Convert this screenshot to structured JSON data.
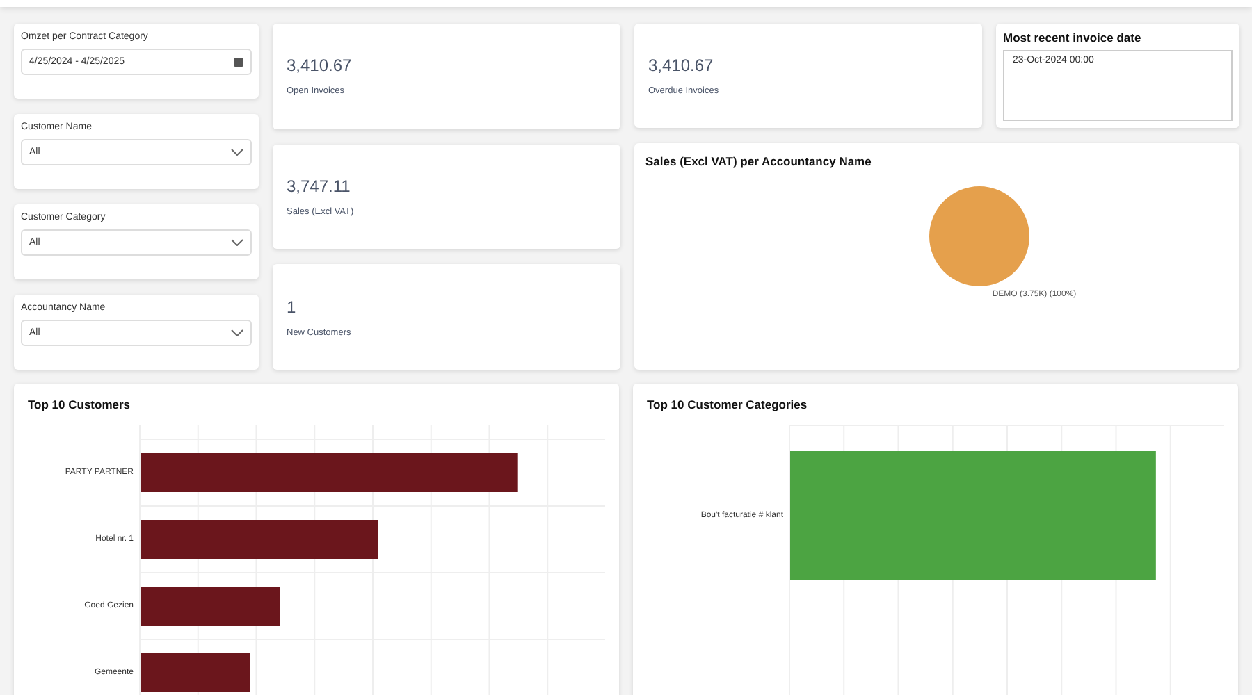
{
  "filters": [
    {
      "kind": "date",
      "label": "Omzet per Contract Category",
      "value": "4/25/2024 - 4/25/2025"
    },
    {
      "kind": "dropdown",
      "label": "Customer Name",
      "value": "All"
    },
    {
      "kind": "dropdown",
      "label": "Customer Category",
      "value": "All"
    },
    {
      "kind": "dropdown",
      "label": "Accountancy Name",
      "value": "All"
    }
  ],
  "kpis": [
    {
      "value": "3,410.67",
      "label": "Open Invoices"
    },
    {
      "value": "3,747.11",
      "label": "Sales (Excl VAT)"
    },
    {
      "value": "1",
      "label": "New Customers"
    }
  ],
  "overdue": {
    "value": "3,410.67",
    "label": "Overdue Invoices"
  },
  "recent_invoice": {
    "title": "Most recent invoice date",
    "value": "23-Oct-2024 00:00"
  },
  "pie": {
    "title": "Sales (Excl VAT) per Accountancy Name",
    "slice_label": "DEMO (3.75K) (100%)",
    "color": "#e5a04c"
  },
  "top_customers": {
    "title": "Top 10 Customers",
    "labels": [
      "PARTY PARTNER",
      "Hotel nr. 1",
      "Goed Gezien",
      "Gemeente"
    ],
    "color": "#6b161c"
  },
  "top_categories": {
    "title": "Top 10 Customer Categories",
    "labels": [
      "Bou't facturatie # klant"
    ],
    "color": "#4ca442"
  }
}
